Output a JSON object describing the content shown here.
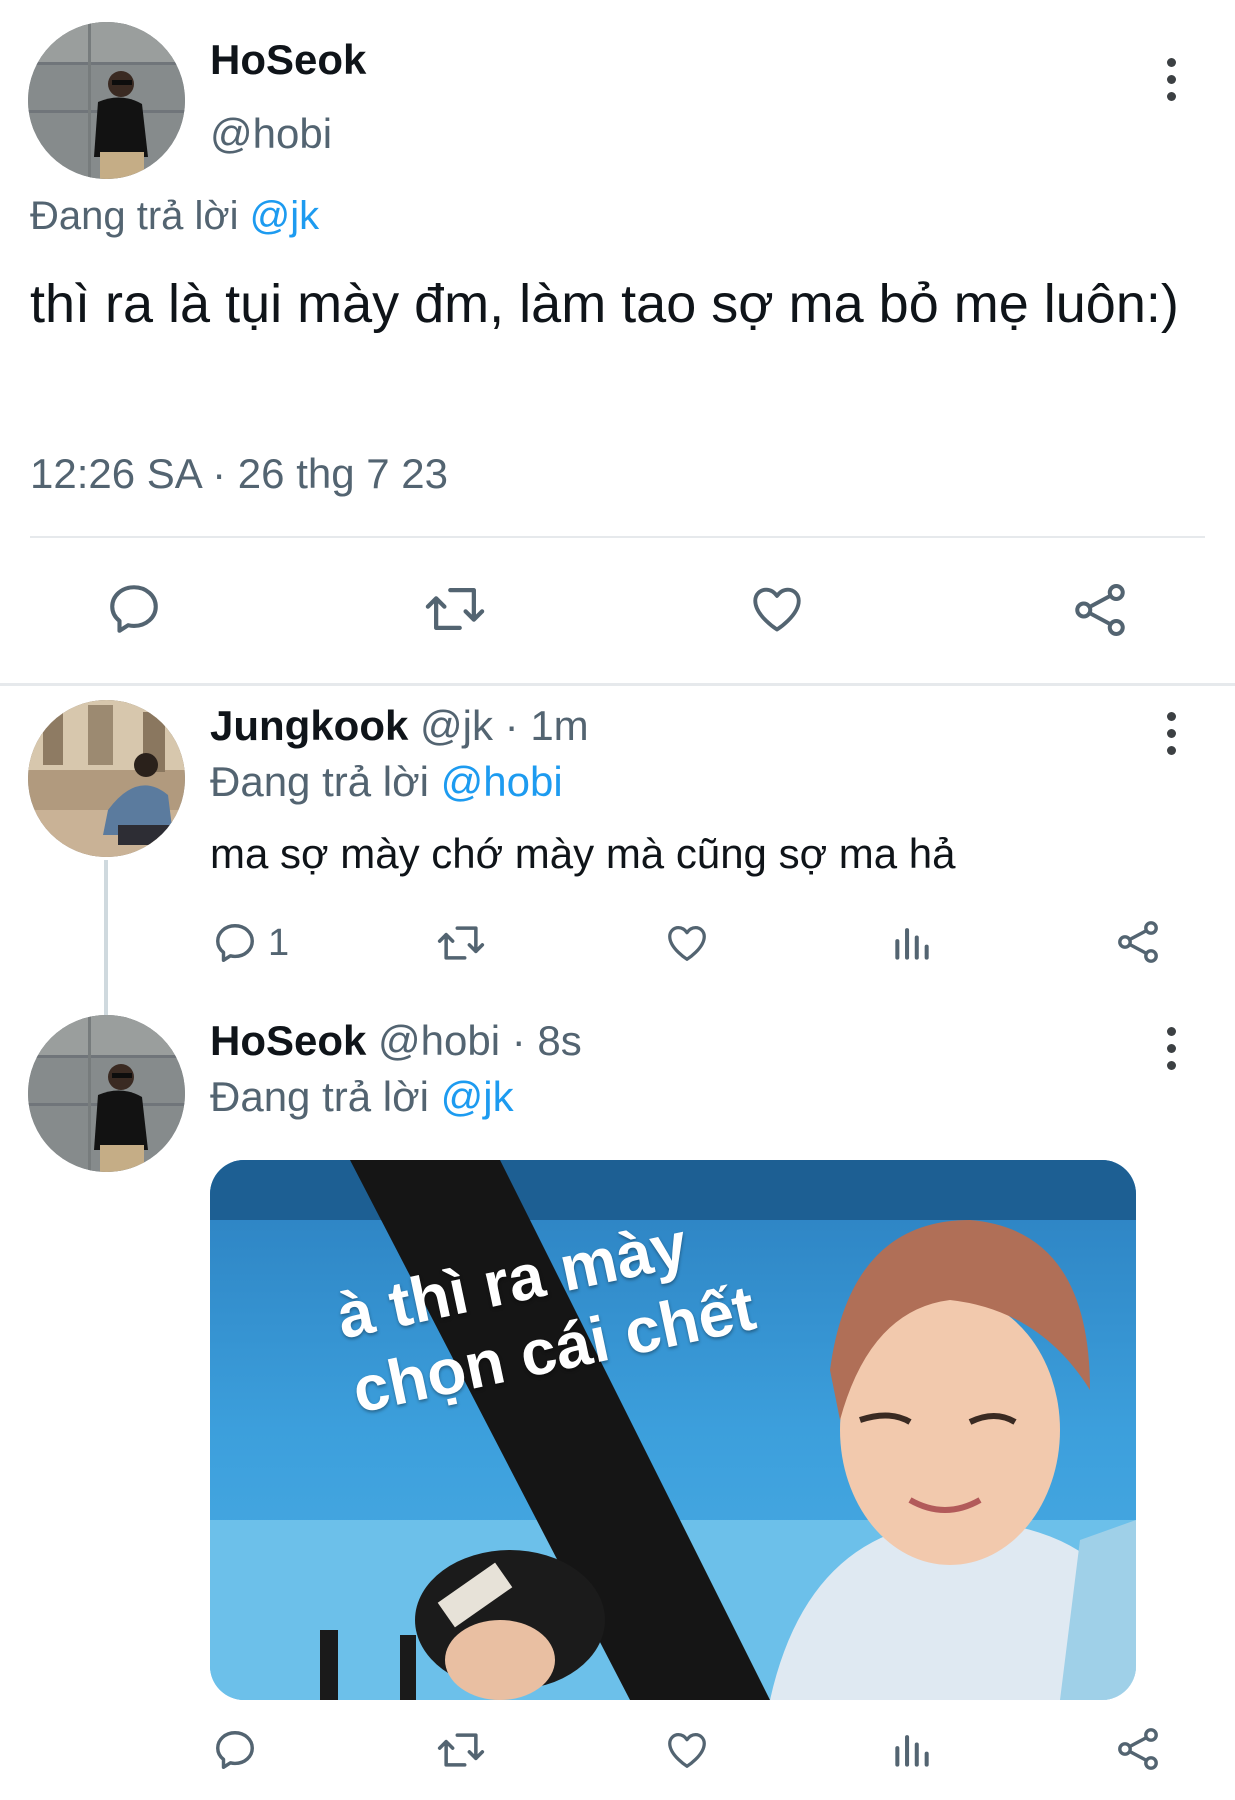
{
  "main_tweet": {
    "display_name": "HoSeok",
    "handle": "@hobi",
    "replying_prefix": "Đang trả lời",
    "replying_to": "@jk",
    "text": "thì ra là tụi mày đm, làm tao sợ ma bỏ mẹ luôn:)",
    "timestamp": "12:26 SA · 26 thg 7 23"
  },
  "reply_1": {
    "display_name": "Jungkook",
    "handle": "@jk",
    "time": "· 1m",
    "replying_prefix": "Đang trả lời",
    "replying_to": "@hobi",
    "text": "ma sợ mày chớ mày mà cũng sợ ma hả",
    "reply_count": "1"
  },
  "reply_2": {
    "display_name": "HoSeok",
    "handle": "@hobi",
    "time": "· 8s",
    "replying_prefix": "Đang trả lời",
    "replying_to": "@jk",
    "media_caption_line1": "à thì ra mày",
    "media_caption_line2": "chọn cái chết"
  },
  "icons": {
    "reply": "speech-bubble-icon",
    "retweet": "retweet-arrows-icon",
    "like": "heart-icon",
    "views": "bar-chart-icon",
    "share": "share-nodes-icon",
    "more": "vertical-dots-icon"
  },
  "colors": {
    "link": "#1d9bf0",
    "text": "#0f1419",
    "secondary": "#536471",
    "icon": "#536471"
  }
}
